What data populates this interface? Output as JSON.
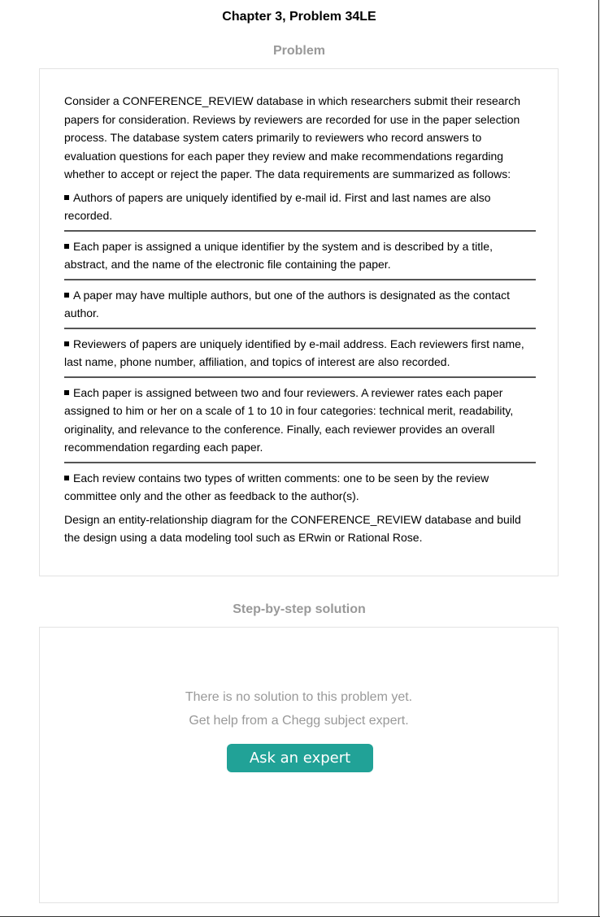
{
  "page": {
    "title": "Chapter 3, Problem 34LE"
  },
  "problem": {
    "heading": "Problem",
    "intro": "Consider a CONFERENCE_REVIEW database in which researchers submit their research papers for consideration. Reviews by reviewers are recorded for use in the paper selection process. The database system caters primarily to reviewers who record answers to evaluation questions for each paper they review and make recommendations regarding whether to accept or reject the paper. The data requirements are summarized as follows:",
    "requirements": [
      "Authors of papers are uniquely identified by e-mail id. First and last names are also recorded.",
      "Each paper is assigned a unique identifier by the system and is described by a title, abstract, and the name of the electronic file containing the paper.",
      "A paper may have multiple authors, but one of the authors is designated as the contact author.",
      "Reviewers of papers are uniquely identified by e-mail address. Each reviewers first name, last name, phone number, affiliation, and topics of interest are also recorded.",
      "Each paper is assigned between two and four reviewers. A reviewer rates each paper assigned to him or her on a scale of 1 to 10 in four categories: technical merit, readability, originality, and relevance to the conference. Finally, each reviewer provides an overall recommendation regarding each paper.",
      "Each review contains two types of written comments: one to be seen by the review committee only and the other as feedback to the author(s)."
    ],
    "closing": "Design an entity-relationship diagram for the CONFERENCE_REVIEW database and build the design using a data modeling tool such as ERwin or Rational Rose."
  },
  "solution": {
    "heading": "Step-by-step solution",
    "empty_line1": "There is no solution to this problem yet.",
    "empty_line2": "Get help from a Chegg subject expert.",
    "button_label": "Ask an expert",
    "button_color": "#21a297"
  }
}
